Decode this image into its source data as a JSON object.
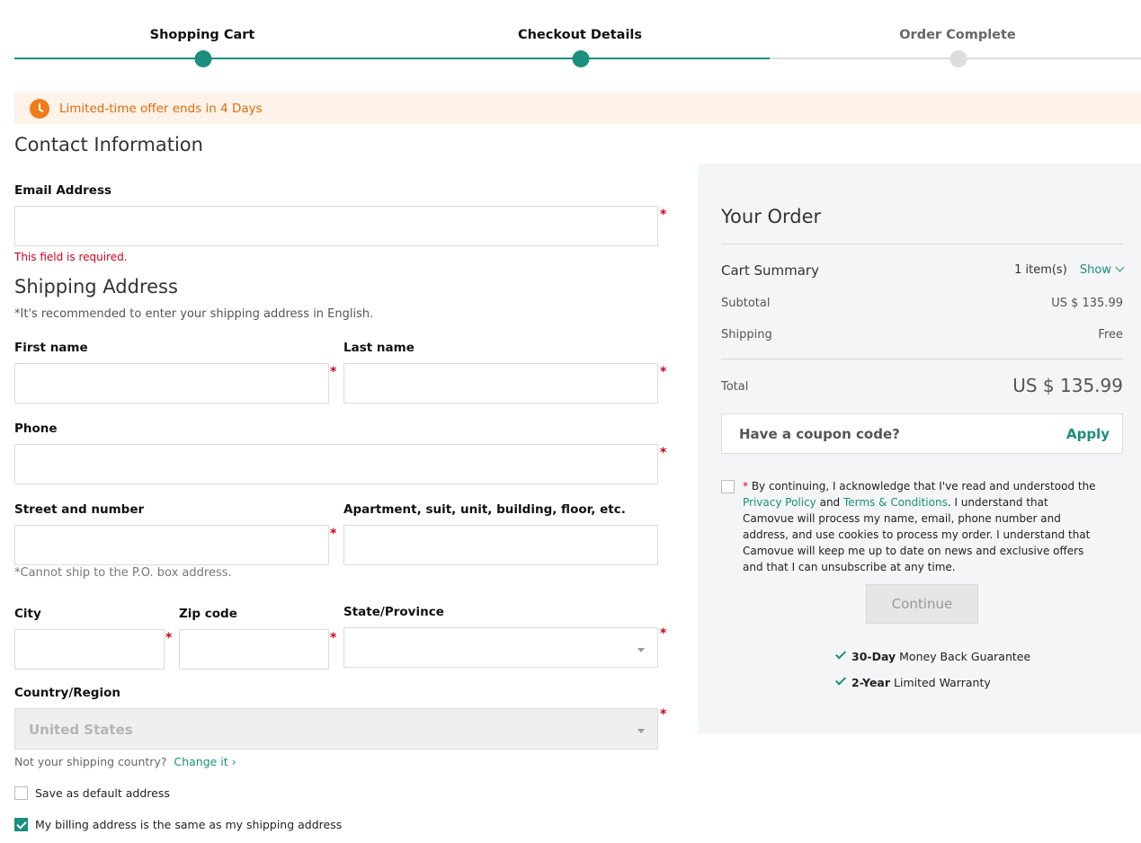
{
  "stepper": {
    "steps": [
      {
        "label": "Shopping Cart",
        "state": "done"
      },
      {
        "label": "Checkout Details",
        "state": "current"
      },
      {
        "label": "Order Complete",
        "state": "upcoming"
      }
    ],
    "active_color": "#1a8f7d",
    "inactive_color": "#dddddd"
  },
  "offer": {
    "text": "Limited-time offer ends in  4 Days",
    "icon": "clock-icon",
    "color": "#e06a10"
  },
  "contact": {
    "heading": "Contact Information",
    "email_label": "Email Address",
    "email_error": "This field is required."
  },
  "shipping": {
    "heading": "Shipping Address",
    "note": "*It's recommended to enter your shipping address in English.",
    "first_name_label": "First name",
    "last_name_label": "Last name",
    "phone_label": "Phone",
    "street_label": "Street and number",
    "apartment_label": "Apartment, suit, unit, building, floor, etc.",
    "po_box_note": "*Cannot ship to the P.O. box address.",
    "city_label": "City",
    "zip_label": "Zip code",
    "state_label": "State/Province",
    "country_label": "Country/Region",
    "country_value": "United States",
    "not_country_text": "Not your shipping country?",
    "change_link": "Change it",
    "save_default_label": "Save as default address",
    "billing_same_label": "My billing address is the same as my shipping address",
    "required_mark": "*"
  },
  "order": {
    "title": "Your Order",
    "cart_summary_label": "Cart Summary",
    "item_count": "1 item(s)",
    "show_label": "Show",
    "subtotal_label": "Subtotal",
    "subtotal_value": "US $ 135.99",
    "shipping_label": "Shipping",
    "shipping_value": "Free",
    "total_label": "Total",
    "total_value": "US $ 135.99",
    "coupon_placeholder": "Have a coupon code?",
    "apply_label": "Apply",
    "consent": {
      "required_mark": "*",
      "text_1": " By continuing, I acknowledge that I've read and understood the ",
      "privacy_link": "Privacy Policy",
      "text_2": " and ",
      "terms_link": "Terms & Conditions",
      "text_3": ". I understand that Camovue will process my name, email, phone number and address, and use cookies to process my order. I understand that Camovue will keep me up to date on news and exclusive offers and that I can unsubscribe at any time."
    },
    "continue_label": "Continue",
    "guarantees": [
      {
        "bold": "30-Day",
        "rest": " Money Back Guarantee"
      },
      {
        "bold": "2-Year",
        "rest": " Limited Warranty"
      }
    ]
  }
}
